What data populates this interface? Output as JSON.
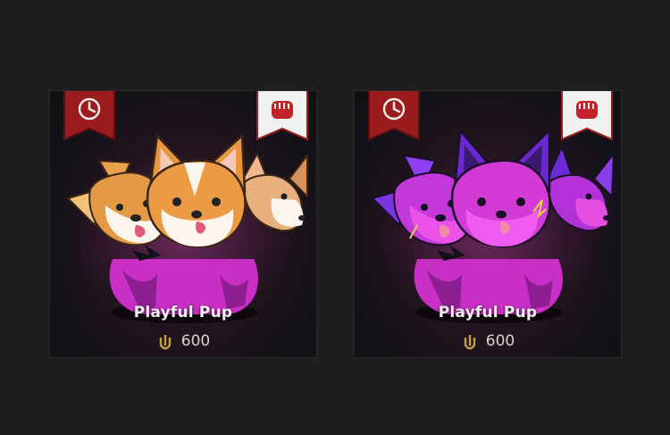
{
  "cards": [
    {
      "name": "Playful Pup",
      "price": "600",
      "variant": "standard"
    },
    {
      "name": "Playful Pup",
      "price": "600",
      "variant": "chroma-purple"
    }
  ],
  "icons": {
    "left_ribbon": "clock-icon",
    "right_ribbon": "riot-fist-icon",
    "currency": "riot-points-icon"
  },
  "colors": {
    "background": "#1e1e1e",
    "ribbon_red": "#9b1c1c",
    "ribbon_white": "#f1f1f1",
    "currency_gold": "#c8a039",
    "pup_magenta": "#d62fd6",
    "pup_purple": "#7b2fe0"
  }
}
